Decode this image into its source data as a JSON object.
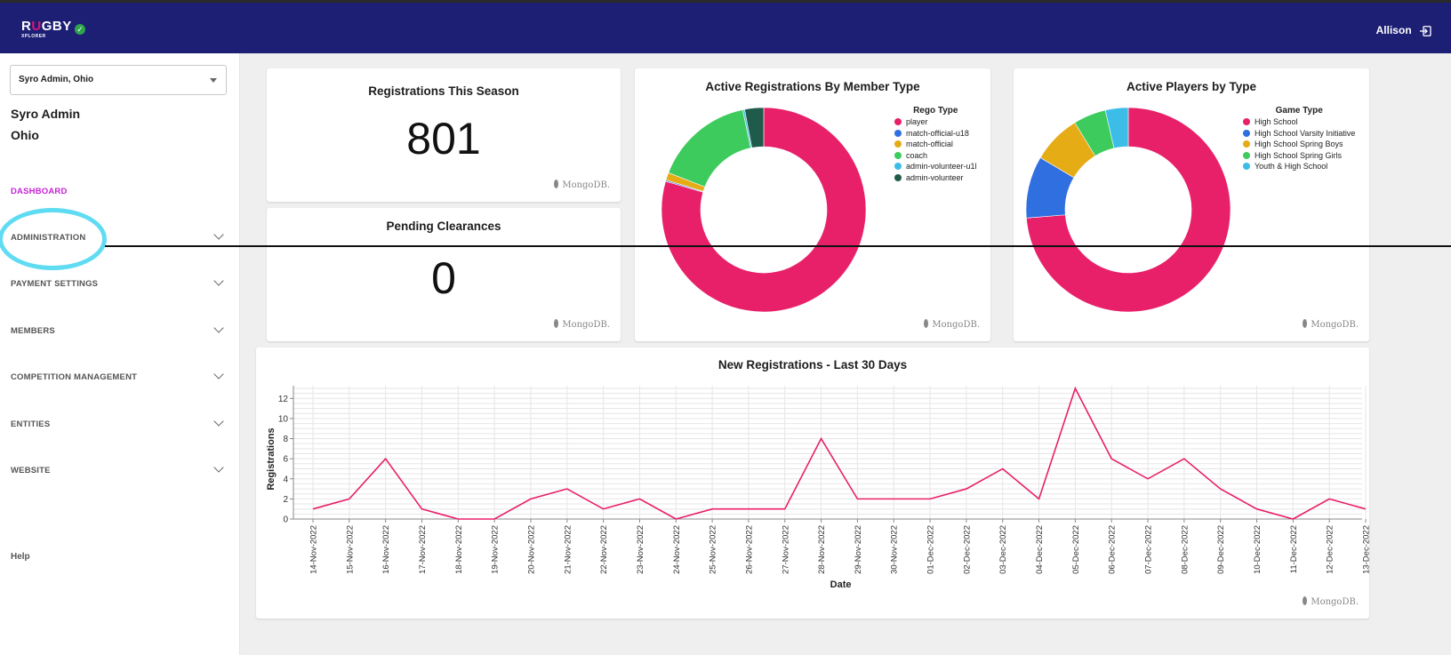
{
  "header": {
    "logo_main_pre": "R",
    "logo_main_u": "U",
    "logo_main_post": "GBY",
    "logo_sub": "XPLORER",
    "user_name": "Allison"
  },
  "sidebar": {
    "org_select_value": "Syro Admin, Ohio",
    "org_line1": "Syro Admin",
    "org_line2": "Ohio",
    "nav": [
      {
        "label": "DASHBOARD",
        "active": true
      },
      {
        "label": "ADMINISTRATION"
      },
      {
        "label": "PAYMENT SETTINGS"
      },
      {
        "label": "MEMBERS"
      },
      {
        "label": "COMPETITION MANAGEMENT"
      },
      {
        "label": "ENTITIES"
      },
      {
        "label": "WEBSITE"
      }
    ],
    "help": "Help"
  },
  "cards": {
    "registrations": {
      "title": "Registrations This Season",
      "value": "801"
    },
    "clearances": {
      "title": "Pending Clearances",
      "value": "0"
    },
    "member_type": {
      "title": "Active Registrations By Member Type"
    },
    "players_type": {
      "title": "Active Players by Type"
    },
    "new_regs": {
      "title": "New Registrations - Last 30 Days"
    },
    "mongodb_label": "MongoDB."
  },
  "colors": {
    "topbar": "#1c1f73",
    "accent_pink": "#e8206a",
    "active_nav": "#c623d6",
    "highlight": "#5fdcf2"
  },
  "chart_data": [
    {
      "type": "pie",
      "title": "Active Registrations By Member Type",
      "legend_title": "Rego Type",
      "legend_position": "top-right",
      "labels": [
        "player",
        "match-official-u18",
        "match-official",
        "coach",
        "admin-volunteer-u1l",
        "admin-volunteer"
      ],
      "values": [
        79.5,
        0.2,
        1.2,
        15.8,
        0.3,
        3.0
      ],
      "colors": [
        "#e8206a",
        "#2f6fdf",
        "#e5ac16",
        "#3ecb5e",
        "#3cbde8",
        "#1f5b4a"
      ]
    },
    {
      "type": "pie",
      "title": "Active Players by Type",
      "legend_title": "Game Type",
      "legend_position": "top-right",
      "labels": [
        "High School",
        "High School Varsity Initiative",
        "High School Spring Boys",
        "High School Spring Girls",
        "Youth & High School"
      ],
      "values": [
        71.5,
        9.5,
        7.5,
        5.0,
        3.5
      ],
      "colors": [
        "#e8206a",
        "#2f6fdf",
        "#e5ac16",
        "#3ecb5e",
        "#3cbde8"
      ]
    },
    {
      "type": "line",
      "title": "New Registrations - Last 30 Days",
      "xlabel": "Date",
      "ylabel": "Registrations",
      "ylim": [
        0,
        13
      ],
      "yticks": [
        0,
        2,
        4,
        6,
        8,
        10,
        12
      ],
      "grid": true,
      "x": [
        "14-Nov-2022",
        "15-Nov-2022",
        "16-Nov-2022",
        "17-Nov-2022",
        "18-Nov-2022",
        "19-Nov-2022",
        "20-Nov-2022",
        "21-Nov-2022",
        "22-Nov-2022",
        "23-Nov-2022",
        "24-Nov-2022",
        "25-Nov-2022",
        "26-Nov-2022",
        "27-Nov-2022",
        "28-Nov-2022",
        "29-Nov-2022",
        "30-Nov-2022",
        "01-Dec-2022",
        "02-Dec-2022",
        "03-Dec-2022",
        "04-Dec-2022",
        "05-Dec-2022",
        "06-Dec-2022",
        "07-Dec-2022",
        "08-Dec-2022",
        "09-Dec-2022",
        "10-Dec-2022",
        "11-Dec-2022",
        "12-Dec-2022",
        "13-Dec-2022"
      ],
      "series": [
        {
          "values": [
            1,
            2,
            6,
            1,
            0,
            0,
            2,
            3,
            1,
            2,
            0,
            1,
            1,
            1,
            8,
            2,
            2,
            2,
            3,
            5,
            2,
            13,
            6,
            4,
            6,
            3,
            1,
            0,
            2,
            1
          ],
          "color": "#e8206a"
        }
      ]
    }
  ]
}
